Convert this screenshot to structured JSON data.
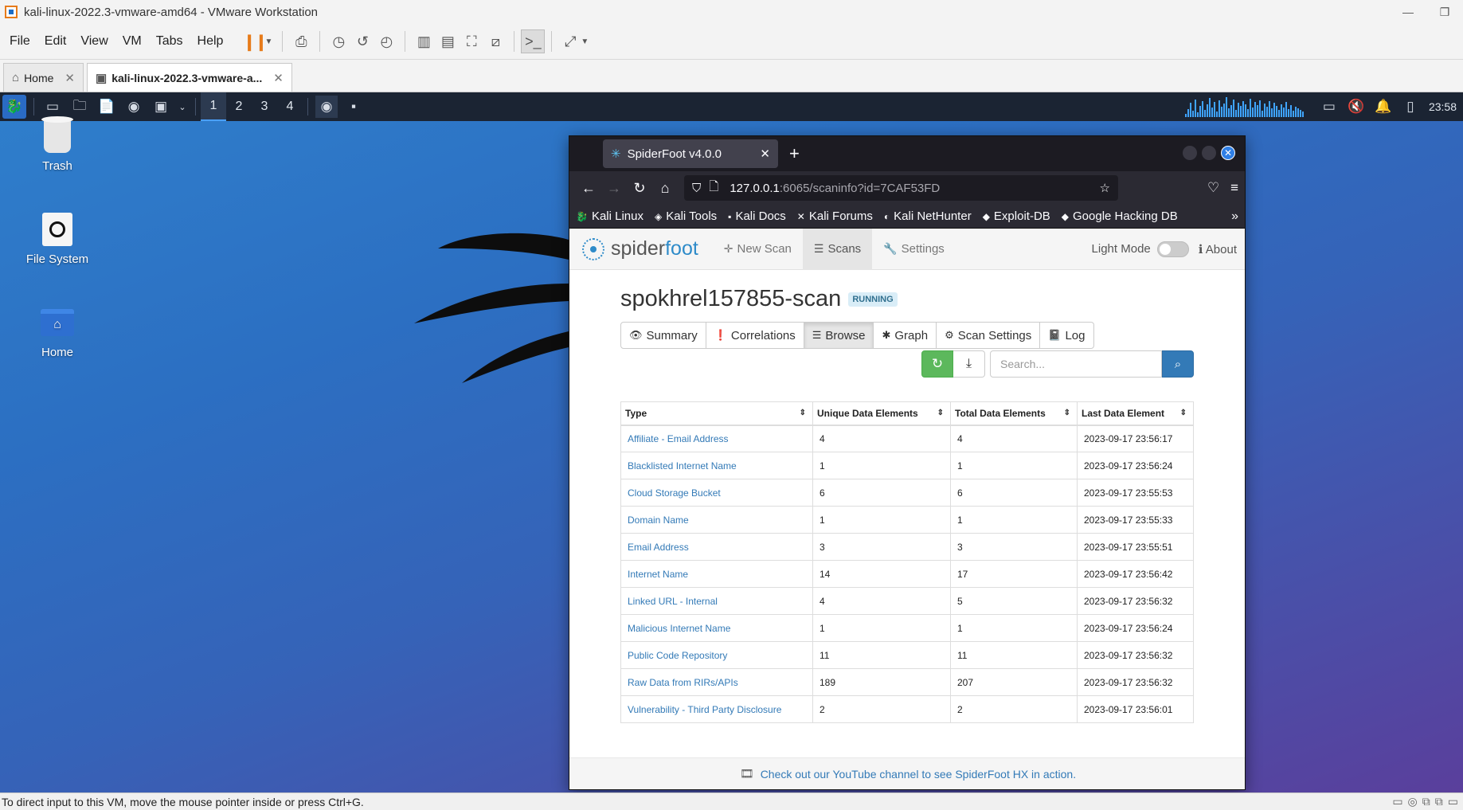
{
  "window": {
    "title": "kali-linux-2022.3-vmware-amd64 - VMware Workstation"
  },
  "menu": [
    "File",
    "Edit",
    "View",
    "VM",
    "Tabs",
    "Help"
  ],
  "vm_tabs": [
    {
      "label": "Home"
    },
    {
      "label": "kali-linux-2022.3-vmware-a..."
    }
  ],
  "kali_panel": {
    "workspaces": [
      "1",
      "2",
      "3",
      "4"
    ],
    "clock": "23:58"
  },
  "desktop": {
    "icons": [
      "Trash",
      "File System",
      "Home"
    ]
  },
  "browser": {
    "tab_title": "SpiderFoot v4.0.0",
    "url_host": "127.0.0.1",
    "url_path": ":6065/scaninfo?id=7CAF53FD",
    "bookmarks": [
      "Kali Linux",
      "Kali Tools",
      "Kali Docs",
      "Kali Forums",
      "Kali NetHunter",
      "Exploit-DB",
      "Google Hacking DB"
    ]
  },
  "spiderfoot": {
    "logo_a": "spider",
    "logo_b": "foot",
    "nav": {
      "new_scan": "New Scan",
      "scans": "Scans",
      "settings": "Settings",
      "light_mode": "Light Mode",
      "about": "About"
    },
    "scan_name": "spokhrel157855-scan",
    "status": "RUNNING",
    "tabs": {
      "summary": "Summary",
      "correlations": "Correlations",
      "browse": "Browse",
      "graph": "Graph",
      "scan_settings": "Scan Settings",
      "log": "Log"
    },
    "search_placeholder": "Search...",
    "table": {
      "headers": [
        "Type",
        "Unique Data Elements",
        "Total Data Elements",
        "Last Data Element"
      ],
      "rows": [
        [
          "Affiliate - Email Address",
          "4",
          "4",
          "2023-09-17 23:56:17"
        ],
        [
          "Blacklisted Internet Name",
          "1",
          "1",
          "2023-09-17 23:56:24"
        ],
        [
          "Cloud Storage Bucket",
          "6",
          "6",
          "2023-09-17 23:55:53"
        ],
        [
          "Domain Name",
          "1",
          "1",
          "2023-09-17 23:55:33"
        ],
        [
          "Email Address",
          "3",
          "3",
          "2023-09-17 23:55:51"
        ],
        [
          "Internet Name",
          "14",
          "17",
          "2023-09-17 23:56:42"
        ],
        [
          "Linked URL - Internal",
          "4",
          "5",
          "2023-09-17 23:56:32"
        ],
        [
          "Malicious Internet Name",
          "1",
          "1",
          "2023-09-17 23:56:24"
        ],
        [
          "Public Code Repository",
          "11",
          "11",
          "2023-09-17 23:56:32"
        ],
        [
          "Raw Data from RIRs/APIs",
          "189",
          "207",
          "2023-09-17 23:56:32"
        ],
        [
          "Vulnerability - Third Party Disclosure",
          "2",
          "2",
          "2023-09-17 23:56:01"
        ]
      ]
    },
    "footer": "Check out our YouTube channel to see SpiderFoot HX in action."
  },
  "status_bar": "To direct input to this VM, move the mouse pointer inside or press Ctrl+G."
}
